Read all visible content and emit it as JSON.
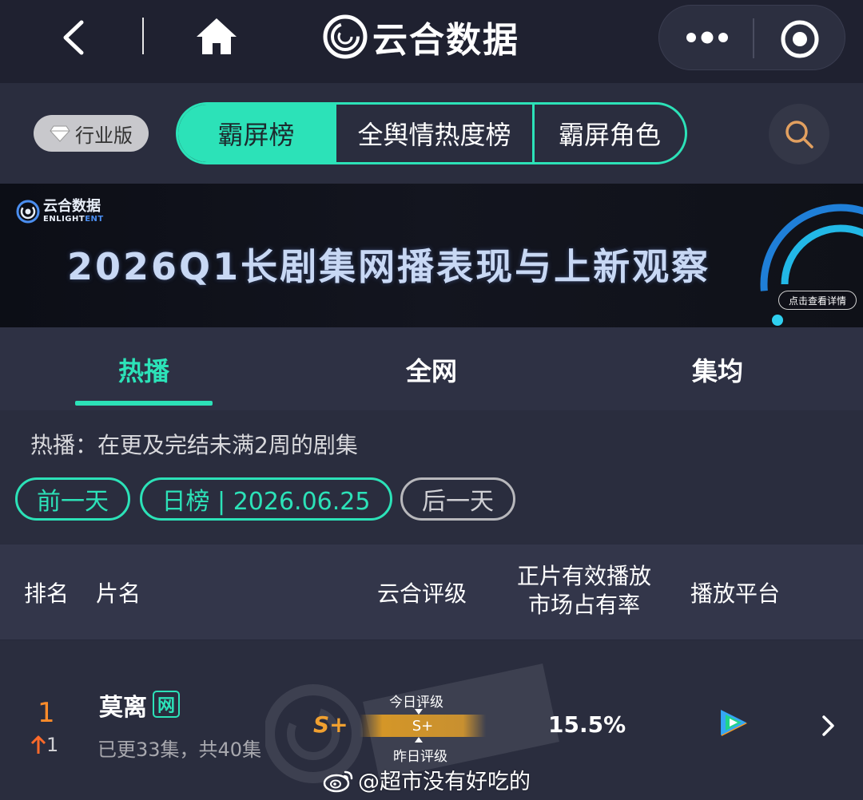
{
  "header": {
    "brand_name": "云合数据",
    "icons": [
      "back-icon",
      "home-icon",
      "yunhe-logo-icon",
      "more-icon",
      "target-icon"
    ]
  },
  "toolbar": {
    "edition_label": "行业版",
    "segments": [
      "霸屏榜",
      "全舆情热度榜",
      "霸屏角色"
    ],
    "active_segment": 0
  },
  "banner": {
    "logo_cn": "云合数据",
    "logo_en_prefix": "ENLIGHT",
    "logo_en_suffix": "ENT",
    "title": "2026Q1长剧集网播表现与上新观察",
    "cta": "点击查看详情"
  },
  "subtabs": {
    "items": [
      "热播",
      "全网",
      "集均"
    ],
    "active": 0
  },
  "filter": {
    "description": "热播：在更及完结未满2周的剧集",
    "prev_label": "前一天",
    "date_label": "日榜 | 2026.06.25",
    "next_label": "后一天"
  },
  "table": {
    "headers": {
      "rank": "排名",
      "name": "片名",
      "rating": "云合评级",
      "share_line1": "正片有效播放",
      "share_line2": "市场占有率",
      "platform": "播放平台"
    },
    "rows": [
      {
        "rank": "1",
        "rank_change": "1",
        "title": "莫离",
        "net_badge": "网",
        "episodes": "已更33集，共40集",
        "grade": "S+",
        "today_label": "今日评级",
        "today_grade": "S+",
        "yesterday_label": "昨日评级",
        "share": "15.5%",
        "platform_icon": "tencent-video-icon"
      }
    ]
  },
  "overlay": {
    "weibo_handle": "@超市没有好吃的"
  },
  "colors": {
    "accent": "#2ce2b8",
    "rank": "#ff8c2a",
    "grade": "#f0a030",
    "background": "#2a2d3e"
  }
}
